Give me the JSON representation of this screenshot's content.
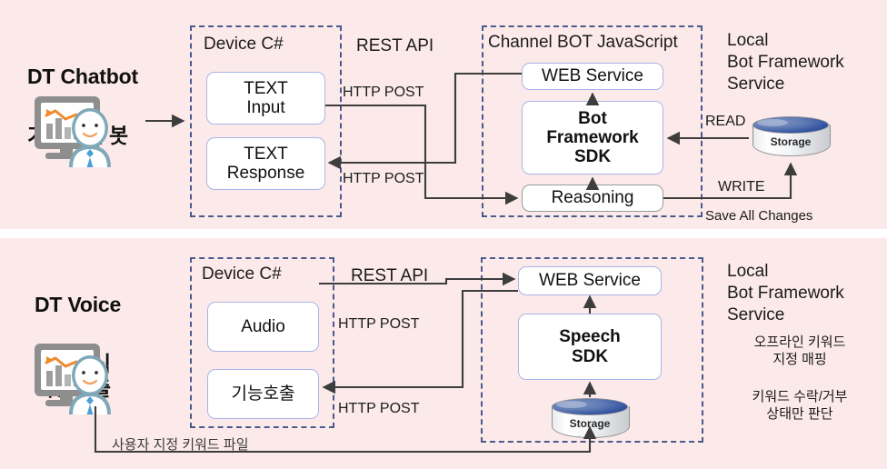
{
  "colors": {
    "panel_bg": "#fceaea",
    "dashed_border": "#4a5a8a",
    "node_border": "#aab4e8",
    "node_border_gray": "#9a9a96",
    "wire": "#3d3d3d",
    "storage_top": "#2f4f9e",
    "tie": "#4a9fd8",
    "chart_line": "#f08a2c",
    "monitor": "#8e8e8e"
  },
  "scenes": [
    {
      "id": "chatbot",
      "title_en": "DT Chatbot",
      "title_kr": "기술지원 봇",
      "icon": "analyst-person-icon",
      "device": {
        "label": "Device C#",
        "nodes": [
          {
            "name": "text-input-node",
            "label": "TEXT\nInput"
          },
          {
            "name": "text-response-node",
            "label": "TEXT\nResponse"
          }
        ]
      },
      "api_label": "REST API",
      "http_labels": [
        "HTTP POST",
        "HTTP POST"
      ],
      "channel": {
        "label": "Channel BOT JavaScript",
        "nodes": [
          {
            "name": "web-service-node",
            "label": "WEB Service",
            "bold": false,
            "border": "blue"
          },
          {
            "name": "bot-framework-sdk-node",
            "label": "Bot\nFramework\nSDK",
            "bold": true,
            "border": "blue"
          },
          {
            "name": "reasoning-node",
            "label": "Reasoning",
            "bold": false,
            "border": "gray"
          }
        ]
      },
      "side_label": "Local\nBot Framework\nService",
      "storage": {
        "name": "storage-cylinder",
        "label": "Storage"
      },
      "read_label": "READ",
      "write_label": "WRITE",
      "save_label": "Save All Changes"
    },
    {
      "id": "voice",
      "title_en": "DT Voice",
      "title_kr": "음성인식\n기능호출",
      "icon": "analyst-person-icon",
      "device": {
        "label": "Device C#",
        "nodes": [
          {
            "name": "audio-node",
            "label": "Audio"
          },
          {
            "name": "function-call-node",
            "label": "기능호출"
          }
        ]
      },
      "api_label": "REST API",
      "http_labels": [
        "HTTP POST",
        "HTTP POST"
      ],
      "channel": {
        "label": "",
        "nodes": [
          {
            "name": "web-service-node",
            "label": "WEB Service",
            "bold": false,
            "border": "blue"
          },
          {
            "name": "speech-sdk-node",
            "label": "Speech\nSDK",
            "bold": true,
            "border": "blue"
          }
        ]
      },
      "side_label": "Local\nBot Framework\nService",
      "notes": [
        "오프라인 키워드\n지정 매핑",
        "키워드 수락/거부\n상태만 판단"
      ],
      "storage": {
        "name": "storage-cylinder",
        "label": "Storage"
      },
      "keyword_file_label": "사용자 지정 키워드 파일"
    }
  ]
}
